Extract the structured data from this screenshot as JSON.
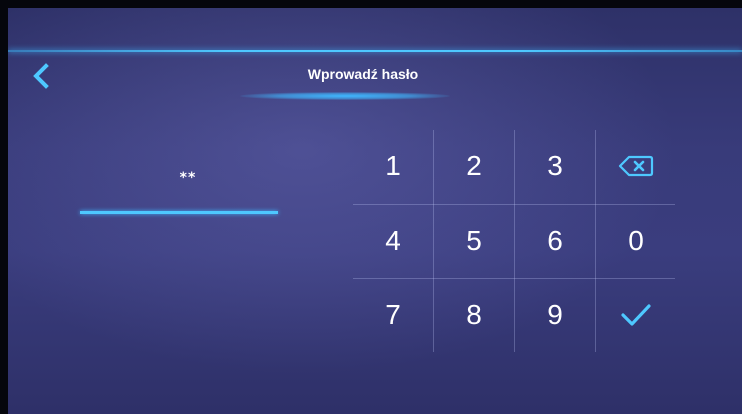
{
  "header": {
    "title": "Wprowadź hasło",
    "back_icon": "chevron-left-icon"
  },
  "password": {
    "masked_value": "**"
  },
  "keypad": {
    "keys": [
      "1",
      "2",
      "3",
      "backspace",
      "4",
      "5",
      "6",
      "0",
      "7",
      "8",
      "9",
      "confirm"
    ],
    "backspace_icon": "backspace-icon",
    "confirm_icon": "checkmark-icon"
  },
  "colors": {
    "accent": "#4ec8ff",
    "background": "#383b7a",
    "text": "#ffffff"
  }
}
